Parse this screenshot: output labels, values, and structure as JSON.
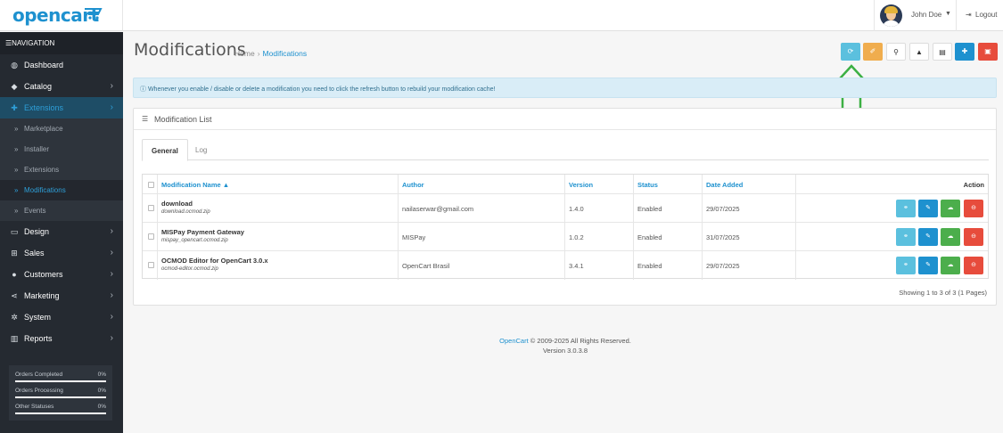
{
  "header": {
    "logo_text": "opencart",
    "user_name": "John Doe",
    "logout_label": "Logout"
  },
  "sidebar": {
    "heading": "NAVIGATION",
    "items": [
      {
        "label": "Dashboard",
        "icon": "dashboard-icon",
        "has_children": false
      },
      {
        "label": "Catalog",
        "icon": "tag-icon",
        "has_children": true
      },
      {
        "label": "Extensions",
        "icon": "puzzle-icon",
        "has_children": true,
        "active": true
      },
      {
        "label": "Design",
        "icon": "monitor-icon",
        "has_children": true
      },
      {
        "label": "Sales",
        "icon": "cart-icon",
        "has_children": true
      },
      {
        "label": "Customers",
        "icon": "user-icon",
        "has_children": true
      },
      {
        "label": "Marketing",
        "icon": "share-icon",
        "has_children": true
      },
      {
        "label": "System",
        "icon": "gear-icon",
        "has_children": true
      },
      {
        "label": "Reports",
        "icon": "bar-chart-icon",
        "has_children": true
      }
    ],
    "extensions_children": [
      "Marketplace",
      "Installer",
      "Extensions",
      "Modifications",
      "Events"
    ],
    "current_child": "Modifications",
    "stats": [
      {
        "label": "Orders Completed",
        "percent": "0%"
      },
      {
        "label": "Orders Processing",
        "percent": "0%"
      },
      {
        "label": "Other Statuses",
        "percent": "0%"
      }
    ]
  },
  "page": {
    "title": "Modifications",
    "breadcrumb": [
      "Home",
      "Modifications"
    ],
    "toolbar_colors": {
      "refresh": "#5bc0de",
      "clear": "#f0ad4e",
      "add": "#1e91cf",
      "delete": "#e74c3c"
    },
    "alert": "Whenever you enable / disable or delete a modification you need to click the refresh button to rebuild your modification cache!"
  },
  "panel": {
    "title": "Modification List",
    "tabs": [
      "General",
      "Log"
    ],
    "active_tab": "General",
    "columns": [
      "Modification Name",
      "Author",
      "Version",
      "Status",
      "Date Added",
      "Action"
    ],
    "sort_column": "Modification Name",
    "rows": [
      {
        "name": "download",
        "file": "download.ocmod.zip",
        "author": "nailaserwar@gmail.com",
        "version": "1.4.0",
        "status": "Enabled",
        "date": "29/07/2025"
      },
      {
        "name": "MISPay Payment Gateway",
        "file": "mispay_opencart.ocmod.zip",
        "author": "MISPay",
        "version": "1.0.2",
        "status": "Enabled",
        "date": "31/07/2025"
      },
      {
        "name": "OCMOD Editor for OpenCart 3.0.x",
        "file": "ocmod-editor.ocmod.zip",
        "author": "OpenCart Brasil",
        "version": "3.4.1",
        "status": "Enabled",
        "date": "29/07/2025"
      }
    ],
    "pagination_text": "Showing 1 to 3 of 3 (1 Pages)"
  },
  "footer": {
    "brand": "OpenCart",
    "copyright": "© 2009-2025 All Rights Reserved.",
    "version": "Version 3.0.3.8"
  },
  "annotation": {
    "arrow_color": "#3cb043"
  }
}
